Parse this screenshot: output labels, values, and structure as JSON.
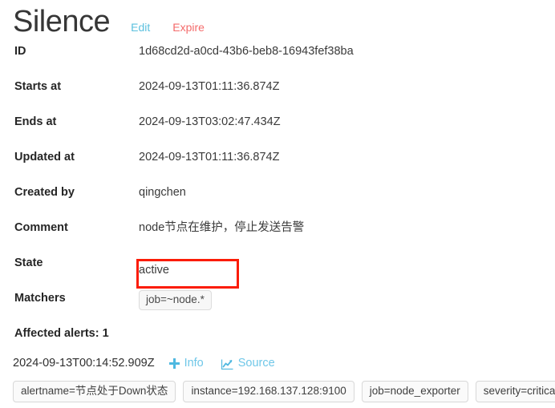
{
  "header": {
    "title": "Silence",
    "actions": [
      {
        "label": "Edit",
        "name": "edit-link",
        "color": "#5bc0de"
      },
      {
        "label": "Expire",
        "name": "expire-link",
        "color": "#f46b6b"
      }
    ]
  },
  "details": {
    "id": {
      "label": "ID",
      "value": "1d68cd2d-a0cd-43b6-beb8-16943fef38ba"
    },
    "starts_at": {
      "label": "Starts at",
      "value": "2024-09-13T01:11:36.874Z"
    },
    "ends_at": {
      "label": "Ends at",
      "value": "2024-09-13T03:02:47.434Z"
    },
    "updated_at": {
      "label": "Updated at",
      "value": "2024-09-13T01:11:36.874Z"
    },
    "created_by": {
      "label": "Created by",
      "value": "qingchen"
    },
    "comment": {
      "label": "Comment",
      "value": "node节点在维护，停止发送告警"
    },
    "state": {
      "label": "State",
      "value": "active",
      "highlight_color": "#fb1c06"
    },
    "matchers": {
      "label": "Matchers",
      "values": [
        "job=~node.*"
      ]
    }
  },
  "affected": {
    "heading": "Affected alerts: 1",
    "alert": {
      "timestamp": "2024-09-13T00:14:52.909Z",
      "info_label": "Info",
      "source_label": "Source",
      "labels": [
        "alertname=节点处于Down状态",
        "instance=192.168.137.128:9100",
        "job=node_exporter",
        "severity=critical"
      ]
    }
  }
}
